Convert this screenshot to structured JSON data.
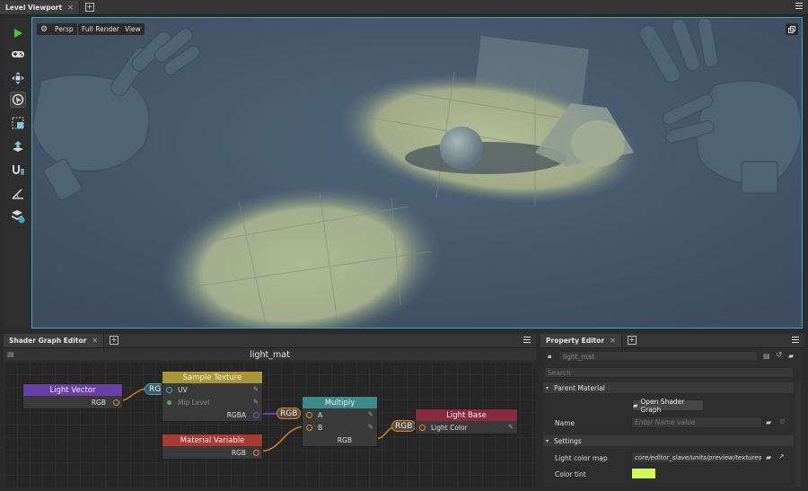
{
  "viewport_panel": {
    "tab_label": "Level Viewport",
    "view_buttons": [
      "Persp",
      "Full Render",
      "View"
    ]
  },
  "toolbar": {
    "tools": [
      "play-icon",
      "gamepad-icon",
      "move-icon",
      "select-icon",
      "scale-icon",
      "snap-to-floor-icon",
      "magnet-grid-icon",
      "angle-icon",
      "layers-icon"
    ]
  },
  "shader_graph": {
    "tab_label": "Shader Graph Editor",
    "title": "light_mat",
    "nodes": {
      "light_vector": {
        "title": "Light Vector",
        "out": "RGB"
      },
      "sample_texture": {
        "title": "Sample Texture",
        "in_uv": "UV",
        "in_mip": "Mip Level",
        "out": "RGBA"
      },
      "material_variable": {
        "title": "Material Variable",
        "out": "RGB"
      },
      "multiply": {
        "title": "Multiply",
        "in_a": "A",
        "in_b": "B",
        "out": "RGB"
      },
      "light_base": {
        "title": "Light Base",
        "in_color": "Light Color"
      }
    },
    "swizzles": {
      "rg": "RG",
      "rgb1": "RGB",
      "rgb2": "RGB"
    }
  },
  "property_editor": {
    "tab_label": "Property Editor",
    "object_name": "light_mat",
    "search_placeholder": "Search",
    "sections": {
      "parent_material": {
        "header": "Parent Material",
        "open_button": "Open Shader Graph",
        "name_label": "Name",
        "name_placeholder": "Enter Name value"
      },
      "settings": {
        "header": "Settings",
        "light_map_label": "Light color map",
        "light_map_value": "core/editor_slave/units/preview/textures/",
        "color_tint_label": "Color tint",
        "color_tint_value": "#cfff5a"
      }
    }
  },
  "colors": {
    "accent": "#3aa7c5",
    "light_vector_header": "#6a3fa6",
    "sample_texture_header": "#a99636",
    "material_variable_header": "#a83a32",
    "multiply_header": "#3c8a8a",
    "light_base_header": "#8a2a3e"
  }
}
